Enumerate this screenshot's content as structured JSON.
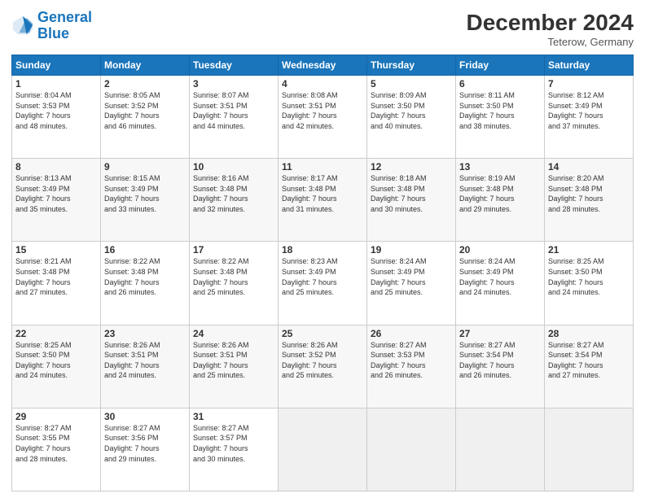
{
  "header": {
    "logo_line1": "General",
    "logo_line2": "Blue",
    "month_title": "December 2024",
    "location": "Teterow, Germany"
  },
  "weekdays": [
    "Sunday",
    "Monday",
    "Tuesday",
    "Wednesday",
    "Thursday",
    "Friday",
    "Saturday"
  ],
  "weeks": [
    [
      {
        "day": 1,
        "sunrise": "8:04 AM",
        "sunset": "3:53 PM",
        "daylight": "7 hours and 48 minutes."
      },
      {
        "day": 2,
        "sunrise": "8:05 AM",
        "sunset": "3:52 PM",
        "daylight": "7 hours and 46 minutes."
      },
      {
        "day": 3,
        "sunrise": "8:07 AM",
        "sunset": "3:51 PM",
        "daylight": "7 hours and 44 minutes."
      },
      {
        "day": 4,
        "sunrise": "8:08 AM",
        "sunset": "3:51 PM",
        "daylight": "7 hours and 42 minutes."
      },
      {
        "day": 5,
        "sunrise": "8:09 AM",
        "sunset": "3:50 PM",
        "daylight": "7 hours and 40 minutes."
      },
      {
        "day": 6,
        "sunrise": "8:11 AM",
        "sunset": "3:50 PM",
        "daylight": "7 hours and 38 minutes."
      },
      {
        "day": 7,
        "sunrise": "8:12 AM",
        "sunset": "3:49 PM",
        "daylight": "7 hours and 37 minutes."
      }
    ],
    [
      {
        "day": 8,
        "sunrise": "8:13 AM",
        "sunset": "3:49 PM",
        "daylight": "7 hours and 35 minutes."
      },
      {
        "day": 9,
        "sunrise": "8:15 AM",
        "sunset": "3:49 PM",
        "daylight": "7 hours and 33 minutes."
      },
      {
        "day": 10,
        "sunrise": "8:16 AM",
        "sunset": "3:48 PM",
        "daylight": "7 hours and 32 minutes."
      },
      {
        "day": 11,
        "sunrise": "8:17 AM",
        "sunset": "3:48 PM",
        "daylight": "7 hours and 31 minutes."
      },
      {
        "day": 12,
        "sunrise": "8:18 AM",
        "sunset": "3:48 PM",
        "daylight": "7 hours and 30 minutes."
      },
      {
        "day": 13,
        "sunrise": "8:19 AM",
        "sunset": "3:48 PM",
        "daylight": "7 hours and 29 minutes."
      },
      {
        "day": 14,
        "sunrise": "8:20 AM",
        "sunset": "3:48 PM",
        "daylight": "7 hours and 28 minutes."
      }
    ],
    [
      {
        "day": 15,
        "sunrise": "8:21 AM",
        "sunset": "3:48 PM",
        "daylight": "7 hours and 27 minutes."
      },
      {
        "day": 16,
        "sunrise": "8:22 AM",
        "sunset": "3:48 PM",
        "daylight": "7 hours and 26 minutes."
      },
      {
        "day": 17,
        "sunrise": "8:22 AM",
        "sunset": "3:48 PM",
        "daylight": "7 hours and 25 minutes."
      },
      {
        "day": 18,
        "sunrise": "8:23 AM",
        "sunset": "3:49 PM",
        "daylight": "7 hours and 25 minutes."
      },
      {
        "day": 19,
        "sunrise": "8:24 AM",
        "sunset": "3:49 PM",
        "daylight": "7 hours and 25 minutes."
      },
      {
        "day": 20,
        "sunrise": "8:24 AM",
        "sunset": "3:49 PM",
        "daylight": "7 hours and 24 minutes."
      },
      {
        "day": 21,
        "sunrise": "8:25 AM",
        "sunset": "3:50 PM",
        "daylight": "7 hours and 24 minutes."
      }
    ],
    [
      {
        "day": 22,
        "sunrise": "8:25 AM",
        "sunset": "3:50 PM",
        "daylight": "7 hours and 24 minutes."
      },
      {
        "day": 23,
        "sunrise": "8:26 AM",
        "sunset": "3:51 PM",
        "daylight": "7 hours and 24 minutes."
      },
      {
        "day": 24,
        "sunrise": "8:26 AM",
        "sunset": "3:51 PM",
        "daylight": "7 hours and 25 minutes."
      },
      {
        "day": 25,
        "sunrise": "8:26 AM",
        "sunset": "3:52 PM",
        "daylight": "7 hours and 25 minutes."
      },
      {
        "day": 26,
        "sunrise": "8:27 AM",
        "sunset": "3:53 PM",
        "daylight": "7 hours and 26 minutes."
      },
      {
        "day": 27,
        "sunrise": "8:27 AM",
        "sunset": "3:54 PM",
        "daylight": "7 hours and 26 minutes."
      },
      {
        "day": 28,
        "sunrise": "8:27 AM",
        "sunset": "3:54 PM",
        "daylight": "7 hours and 27 minutes."
      }
    ],
    [
      {
        "day": 29,
        "sunrise": "8:27 AM",
        "sunset": "3:55 PM",
        "daylight": "7 hours and 28 minutes."
      },
      {
        "day": 30,
        "sunrise": "8:27 AM",
        "sunset": "3:56 PM",
        "daylight": "7 hours and 29 minutes."
      },
      {
        "day": 31,
        "sunrise": "8:27 AM",
        "sunset": "3:57 PM",
        "daylight": "7 hours and 30 minutes."
      },
      null,
      null,
      null,
      null
    ]
  ]
}
